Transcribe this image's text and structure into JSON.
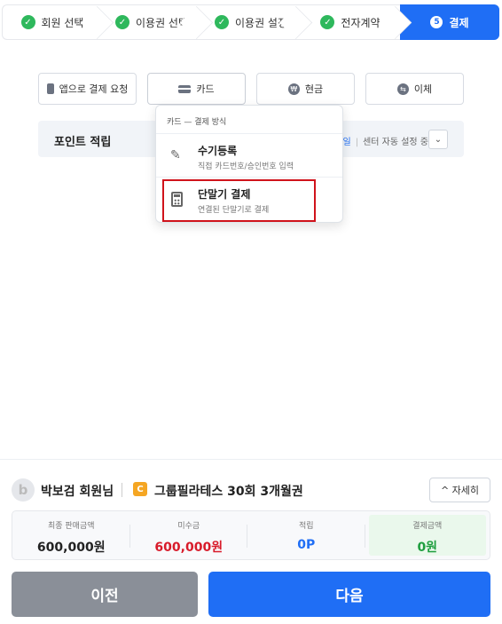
{
  "stepper": {
    "steps": [
      {
        "label": "회원 선택",
        "state": "done"
      },
      {
        "label": "이용권 선택",
        "state": "done"
      },
      {
        "label": "이용권 설정",
        "state": "done"
      },
      {
        "label": "전자계약",
        "state": "done"
      },
      {
        "label": "결제",
        "state": "active",
        "number": "5"
      }
    ]
  },
  "payment_methods": {
    "app": "앱으로 결제 요청",
    "card": "카드",
    "cash": "현금",
    "transfer": "이체"
  },
  "point": {
    "title": "포인트 적립",
    "marker": "일",
    "auto": "센터 자동 설정 중"
  },
  "dropdown": {
    "header": "카드 — 결제 방식",
    "items": [
      {
        "title": "수기등록",
        "sub": "직접 카드번호/승인번호 입력"
      },
      {
        "title": "단말기 결제",
        "sub": "연결된 단말기로 결제"
      }
    ]
  },
  "member": {
    "avatar": "b",
    "name": "박보검 회원님",
    "pass_badge": "C",
    "pass_name": "그룹필라테스 30회 3개월권",
    "detail": "^ 자세히"
  },
  "summary": {
    "final_label": "최종 판매금액",
    "final_value": "600,000원",
    "unpaid_label": "미수금",
    "unpaid_value": "600,000원",
    "points_label": "적립",
    "points_value": "0P",
    "paid_label": "결제금액",
    "paid_value": "0원"
  },
  "actions": {
    "prev": "이전",
    "next": "다음"
  },
  "colors": {
    "accent": "#1f6ef5",
    "unpaid": "#d81b2a",
    "highlight": "#d0131b",
    "done": "#2eb85c"
  }
}
